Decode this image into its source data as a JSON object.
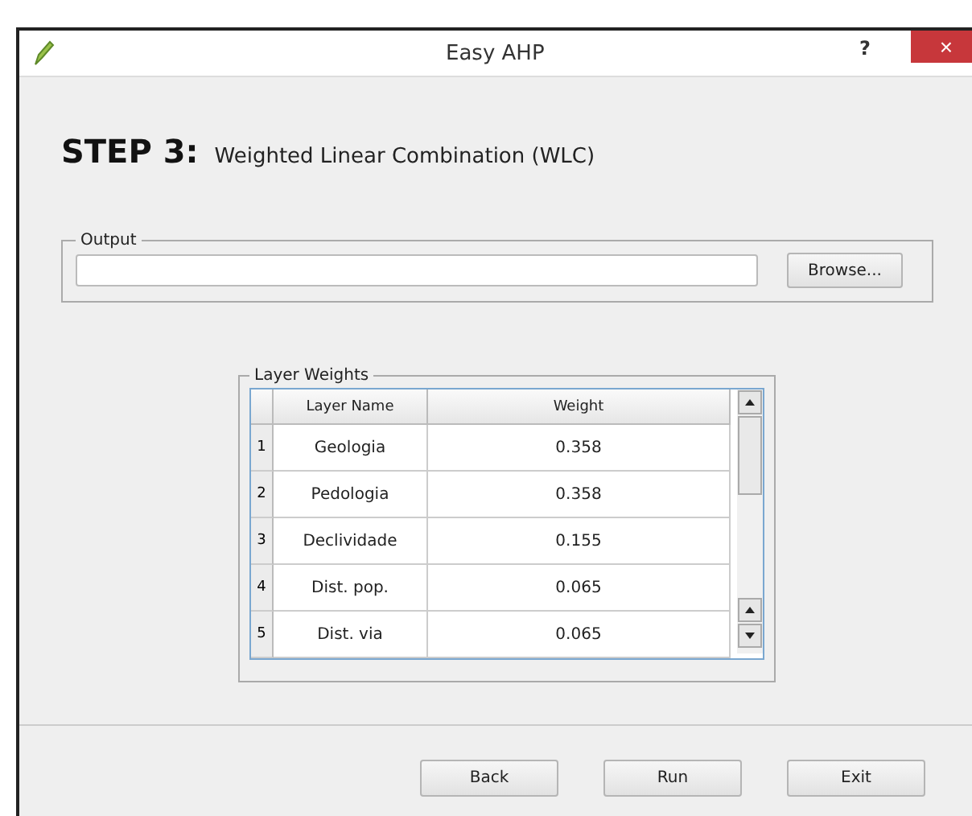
{
  "window": {
    "title": "Easy AHP",
    "help": "?",
    "close": "×"
  },
  "step": {
    "label": "STEP 3:",
    "title": "Weighted Linear Combination (WLC)"
  },
  "output": {
    "group_title": "Output",
    "browse": "Browse..."
  },
  "layer_weights": {
    "group_title": "Layer Weights",
    "columns": [
      "Layer Name",
      "Weight"
    ],
    "rows": [
      {
        "index": "1",
        "name": "Geologia",
        "weight": "0.358"
      },
      {
        "index": "2",
        "name": "Pedologia",
        "weight": "0.358"
      },
      {
        "index": "3",
        "name": "Declividade",
        "weight": "0.155"
      },
      {
        "index": "4",
        "name": "Dist. pop.",
        "weight": "0.065"
      },
      {
        "index": "5",
        "name": "Dist. via",
        "weight": "0.065"
      }
    ]
  },
  "buttons": [
    "Back",
    "Run",
    "Exit"
  ]
}
